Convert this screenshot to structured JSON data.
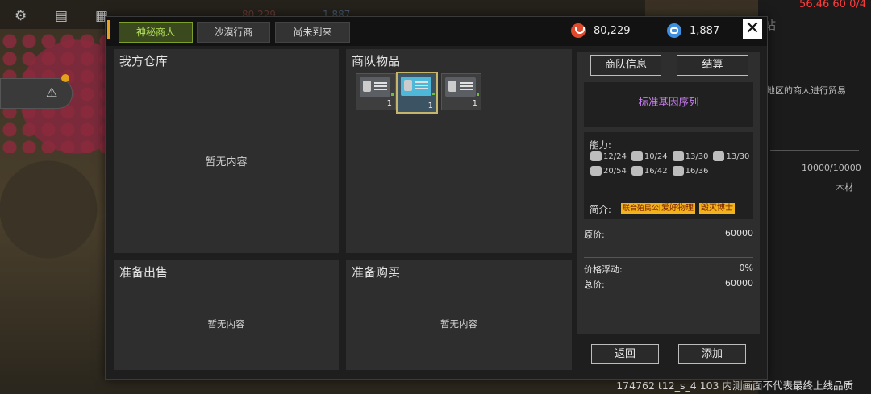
{
  "background": {
    "stats_red": "56.46 60 0/4",
    "top_ghost_red": "80,229",
    "top_ghost_blue": "1,887",
    "right_title": "站",
    "right_text": "地区的商人进行贸易",
    "storage_value": "10000/10000",
    "storage_label": "木材",
    "footer_info": "174762 t12_s_4 103  内测画面不代表最终上线品质"
  },
  "tabs": [
    {
      "label": "神秘商人",
      "active": true
    },
    {
      "label": "沙漠行商",
      "active": false
    },
    {
      "label": "尚未到来",
      "active": false
    }
  ],
  "currency": {
    "red_value": "80,229",
    "blue_value": "1,887"
  },
  "panels": {
    "my_storage": {
      "title": "我方仓库",
      "empty": "暂无内容"
    },
    "caravan_goods": {
      "title": "商队物品"
    },
    "prepare_sell": {
      "title": "准备出售",
      "empty": "暂无内容"
    },
    "prepare_buy": {
      "title": "准备购买",
      "empty": "暂无内容"
    }
  },
  "caravan_items": [
    {
      "qty": "1",
      "selected": false
    },
    {
      "qty": "1",
      "selected": true
    },
    {
      "qty": "1",
      "selected": false
    }
  ],
  "detail": {
    "info_button": "商队信息",
    "settle_button": "结算",
    "item_name": "标准基因序列",
    "ability_label": "能力:",
    "abilities_row1": [
      "12/24",
      "10/24",
      "13/30",
      "13/30"
    ],
    "abilities_row2": [
      "20/54",
      "16/42",
      "16/36"
    ],
    "intro_label": "简介:",
    "tags": [
      "联合殖民公园",
      "爱好物理",
      "毁灭博士"
    ],
    "original_price_label": "原价:",
    "original_price": "60000",
    "fluctuation_label": "价格浮动:",
    "fluctuation": "0%",
    "total_label": "总价:",
    "total": "60000"
  },
  "footer_buttons": {
    "back": "返回",
    "add": "添加"
  },
  "colors": {
    "active_tab": "#b6e35a",
    "item_name": "#c87cf0",
    "tag_bg": "#f2b21a",
    "stats_red": "#ff3b3b"
  }
}
